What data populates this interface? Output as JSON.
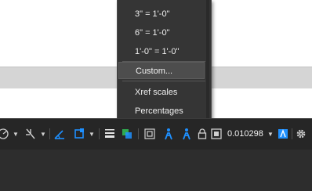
{
  "scale_menu": {
    "items": [
      {
        "label": "3\" = 1'-0\""
      },
      {
        "label": "6\" = 1'-0\""
      },
      {
        "label": "1'-0\" = 1'-0\""
      },
      {
        "label": "Custom..."
      },
      {
        "label": "Xref scales"
      },
      {
        "label": "Percentages"
      }
    ],
    "highlighted_index": 3
  },
  "statusbar": {
    "annotation_scale_value": "0.010298",
    "icons": [
      "polar-tracking-icon",
      "object-snap-tracking-icon",
      "isodraft-icon",
      "object-snap-icon",
      "lineweight-icon",
      "transparency-icon",
      "selection-cycling-icon",
      "annotation-visibility-icon",
      "auto-scale-icon",
      "lock-ui-icon",
      "isolate-objects-icon",
      "annotation-monitor-icon",
      "settings-gear-icon"
    ],
    "accent_color": "#1e90ff",
    "lock_color": "#cfcfcf"
  }
}
